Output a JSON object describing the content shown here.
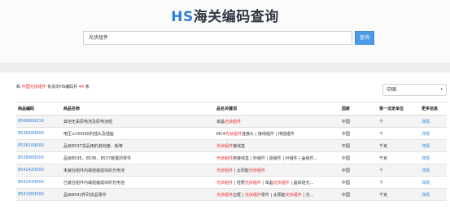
{
  "header": {
    "title_prefix": "HS",
    "title_rest": "海关编码查询"
  },
  "search": {
    "value": "光伏组件",
    "button_label": "查询"
  },
  "summary": {
    "prefix": "和",
    "keyword": "中国光伏组件",
    "middle": "有关的HS编码共",
    "count": "44",
    "suffix": "条"
  },
  "country_select": {
    "selected": "中国",
    "caret": "▾"
  },
  "table": {
    "headers": [
      "商品编码",
      "商品名称",
      "品名关键词",
      "国家",
      "第一法定单位",
      "更多信息"
    ],
    "keyword_highlight": "光伏组件",
    "rows": [
      {
        "code": "8506800019",
        "name": "其他无汞原电池及原电池组",
        "keywords": [
          "单晶",
          "光伏组件"
        ],
        "country": "中国",
        "unit": "个",
        "detail": "详情"
      },
      {
        "code": "8536690000",
        "name": "电压≤1000伏的插头及插座",
        "keywords": [
          "MC4",
          "光伏组件",
          "连接头 | 接线组件 | 排插组件"
        ],
        "country": "中国",
        "unit": "个",
        "detail": "详情"
      },
      {
        "code": "8538109000",
        "name": "品目8537货品用的其他盘、板等",
        "keywords": [
          "光伏组件",
          "接线盒"
        ],
        "country": "中国",
        "unit": "千克",
        "detail": "详情"
      },
      {
        "code": "8538900000",
        "name": "品目8535、8536、8537装置的零件",
        "keywords": [
          "",
          "光伏组件",
          "用接线盒 | 针组件 | 铝组件 | 针组件 | 盖组件..."
        ],
        "country": "中国",
        "unit": "千克",
        "detail": "详情"
      },
      {
        "code": "8541420000",
        "name": "未装在组件内或组装成块的光电池",
        "keywords": [
          "",
          "光伏组件",
          " | 太阳能",
          "光伏组件"
        ],
        "country": "中国",
        "unit": "个",
        "detail": "详情"
      },
      {
        "code": "8541430000",
        "name": "已装在组件内或组装成块的光电池",
        "keywords": [
          "",
          "光伏组件",
          " | 轻质",
          "光伏组件",
          " | 单晶",
          "光伏组件",
          " | 晶体硅光..."
        ],
        "country": "中国",
        "unit": "个",
        "detail": "详情"
      },
      {
        "code": "8541900000",
        "name": "品目8541所列货品零件",
        "keywords": [
          "",
          "光伏组件",
          "边框 | ",
          "光伏组件",
          "零件 | 太阳能",
          "光伏组件",
          " | 光..."
        ],
        "country": "中国",
        "unit": "千克",
        "detail": "详情"
      }
    ]
  },
  "colors": {
    "brand_blue": "#2f7fd6",
    "highlight_red": "#e8262b"
  }
}
